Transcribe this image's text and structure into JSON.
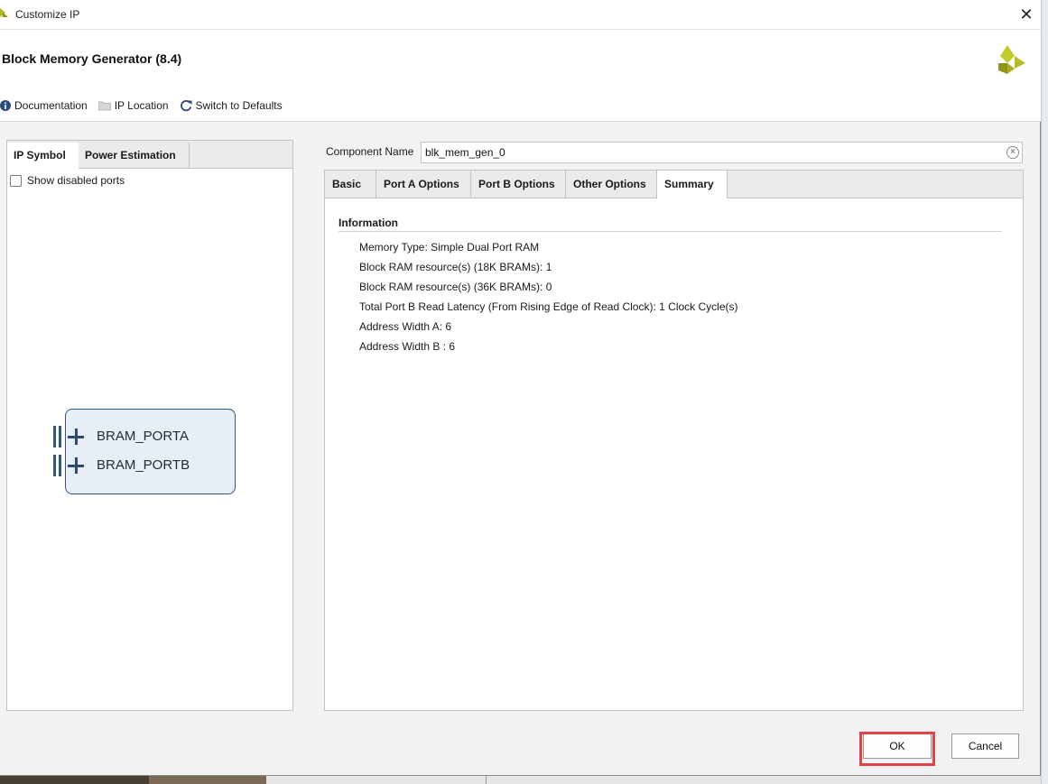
{
  "window": {
    "title": "Customize IP",
    "close_glyph": "✕"
  },
  "header": {
    "ip_name": "Block Memory Generator (8.4)",
    "toolbar": [
      {
        "label": "Documentation",
        "icon": "info-icon"
      },
      {
        "label": "IP Location",
        "icon": "folder-icon"
      },
      {
        "label": "Switch to Defaults",
        "icon": "refresh-icon"
      }
    ]
  },
  "left_panel": {
    "tabs": [
      "IP Symbol",
      "Power Estimation"
    ],
    "active_tab": "IP Symbol",
    "show_disabled_ports_label": "Show disabled ports",
    "show_disabled_ports_checked": false,
    "ports": [
      "BRAM_PORTA",
      "BRAM_PORTB"
    ]
  },
  "component": {
    "label": "Component Name",
    "value": "blk_mem_gen_0",
    "clear_glyph": "×"
  },
  "right_panel": {
    "tabs": [
      "Basic",
      "Port A Options",
      "Port B Options",
      "Other Options",
      "Summary"
    ],
    "active_tab": "Summary",
    "section_title": "Information",
    "items": [
      "Memory Type: Simple Dual Port RAM",
      "Block RAM resource(s) (18K BRAMs): 1",
      "Block RAM resource(s) (36K BRAMs): 0",
      "Total Port B Read Latency (From Rising Edge of Read Clock): 1 Clock Cycle(s)",
      "Address Width A: 6",
      "Address Width B : 6"
    ]
  },
  "buttons": {
    "ok": "OK",
    "cancel": "Cancel"
  },
  "colors": {
    "highlight": "#e0434a",
    "symbol_border": "#2e5683",
    "symbol_fill": "#e8eef5"
  }
}
